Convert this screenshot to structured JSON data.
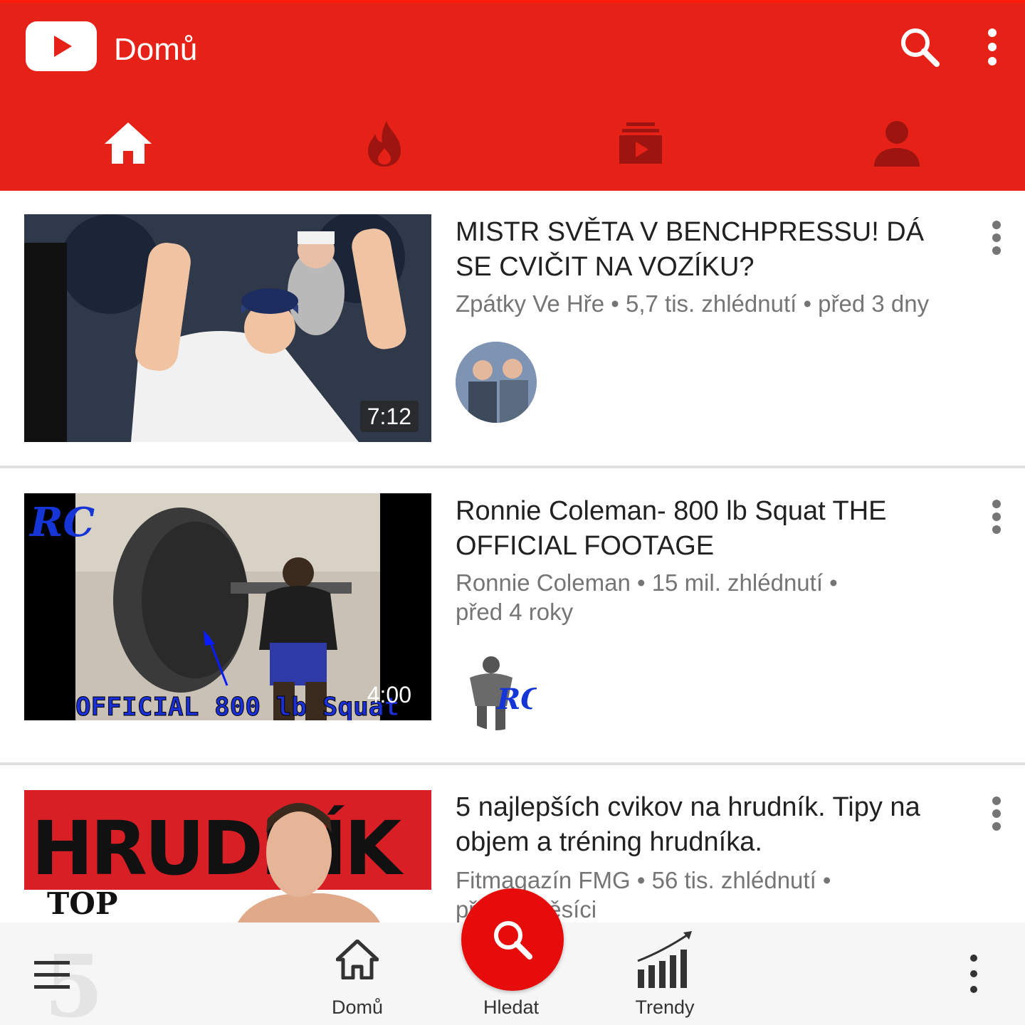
{
  "header": {
    "title": "Domů",
    "logo_icon": "youtube-logo-icon",
    "search_icon": "search-icon",
    "more_icon": "more-vert-icon"
  },
  "tabs": [
    {
      "icon": "home-icon",
      "active": true
    },
    {
      "icon": "trending-flame-icon",
      "active": false
    },
    {
      "icon": "subscriptions-icon",
      "active": false
    },
    {
      "icon": "account-icon",
      "active": false
    }
  ],
  "videos": [
    {
      "title": "MISTR SVĚTA V BENCHPRESSU! DÁ SE CVIČIT NA VOZÍKU?",
      "meta": "Zpátky Ve Hře • 5,7 tis. zhlédnutí • před 3 dny",
      "duration": "7:12"
    },
    {
      "title": "Ronnie Coleman- 800 lb Squat THE OFFICIAL FOOTAGE",
      "meta": "Ronnie Coleman • 15 mil. zhlédnutí • před 4 roky",
      "duration": "4:00",
      "thumb_logo": "RC",
      "thumb_caption": "OFFICIAL 800 lb Squat"
    },
    {
      "title": "5 najlepších cvikov na hrudník. Tipy na objem a tréning hrudníka.",
      "meta": "Fitmagazín FMG • 56 tis. zhlédnutí • před 2 měsíci",
      "thumb_banner": "HRUDNÍK",
      "thumb_top": "TOP",
      "thumb_number": "5"
    }
  ],
  "bottom_nav": {
    "menu_icon": "hamburger-menu-icon",
    "home_label": "Domů",
    "search_label": "Hledat",
    "trending_label": "Trendy",
    "more_icon": "more-vert-icon"
  },
  "colors": {
    "brand_red": "#e62117",
    "fab_red": "#e60c0c",
    "tab_inactive": "#9e1410"
  }
}
